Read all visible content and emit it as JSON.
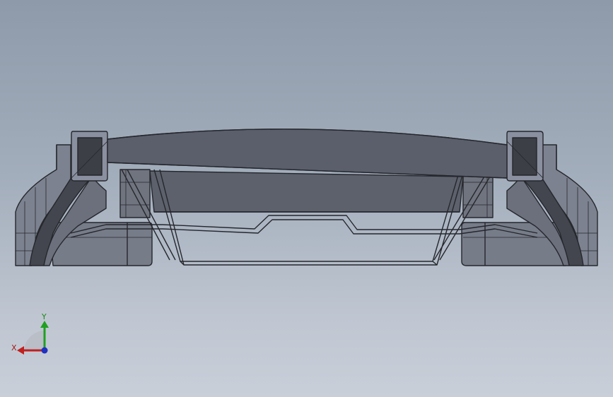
{
  "viewport": {
    "background_top": "#8e9aaa",
    "background_bottom": "#c9cfd9"
  },
  "model": {
    "body_color": "#5c606b",
    "edge_color": "#25272c",
    "side_color": "#7a7f8c",
    "side_light_color": "#8d92a0"
  },
  "triad": {
    "x_label": "X",
    "y_label": "Y",
    "x_color": "#c02020",
    "y_color": "#20a020",
    "z_color": "#2030c0"
  }
}
